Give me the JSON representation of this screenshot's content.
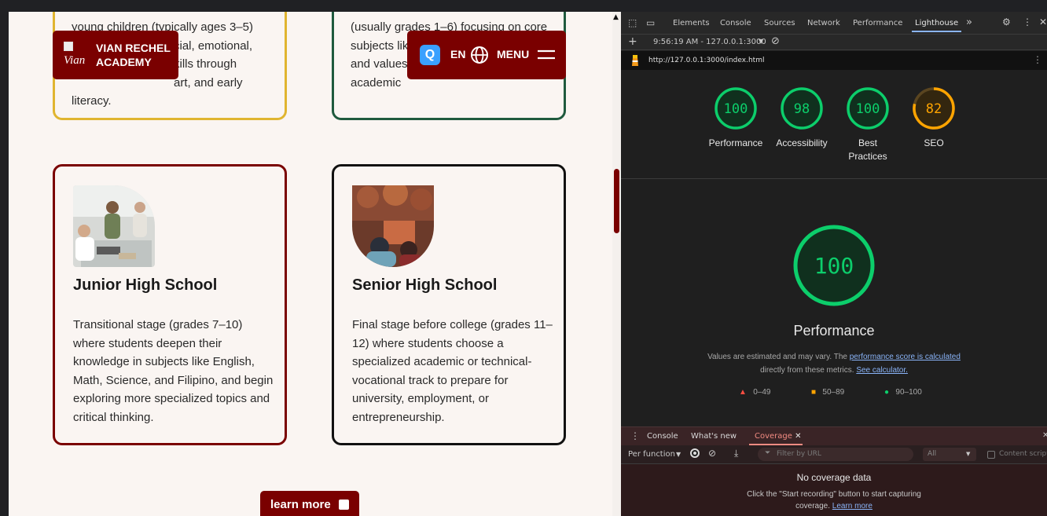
{
  "site": {
    "logo": {
      "alt_text": "Vian",
      "name_line1": "VIAN RECHEL",
      "name_line2": "ACADEMY"
    },
    "nav": {
      "lang": "EN",
      "menu_label": "MENU",
      "assistant_icon_letter": "Q"
    },
    "top_cards": {
      "left_lines": [
        "young children (typically ages 3–5)",
        "cial, emotional,",
        "kills through",
        "art, and early",
        "literacy."
      ],
      "right_lines": [
        "(usually grades 1–6) focusing on core",
        "subjects lik",
        "and values",
        "academic"
      ]
    },
    "cards": [
      {
        "title": "Junior High School",
        "description": "Transitional stage (grades 7–10) where students deepen their knowledge in subjects like English, Math, Science, and Filipino, and begin exploring more specialized topics and critical thinking.",
        "border_color": "#7a0000"
      },
      {
        "title": "Senior High School",
        "description": "Final stage before college (grades 11–12) where students choose a specialized academic or technical-vocational track to prepare for university, employment, or entrepreneurship.",
        "border_color": "#111111"
      }
    ],
    "learn_more": "learn more",
    "colors": {
      "brand": "#7a0000",
      "card_yellow": "#e0b530",
      "card_green": "#1f5a3e"
    }
  },
  "devtools": {
    "tabs": [
      "Elements",
      "Console",
      "Sources",
      "Network",
      "Performance",
      "Lighthouse"
    ],
    "active_tab": "Lighthouse",
    "more_tabs": "»",
    "report_selector": "9:56:19 AM - 127.0.0.1:3000",
    "url": "http://127.0.0.1:3000/index.html",
    "scores": [
      {
        "label": "Performance",
        "value": 100,
        "color": "#0cce6b"
      },
      {
        "label": "Accessibility",
        "value": 98,
        "color": "#0cce6b"
      },
      {
        "label": "Best Practices",
        "value": 100,
        "color": "#0cce6b"
      },
      {
        "label": "SEO",
        "value": 82,
        "color": "#ffa400"
      }
    ],
    "main_score": {
      "label": "Performance",
      "value": 100
    },
    "note_prefix": "Values are estimated and may vary. The ",
    "note_link1": "performance score is calculated",
    "note_middle": " directly from these metrics. ",
    "note_link2": "See calculator.",
    "legend": [
      {
        "range": "0–49",
        "color": "#ff4e42"
      },
      {
        "range": "50–89",
        "color": "#ffa400"
      },
      {
        "range": "90–100",
        "color": "#0cce6b"
      }
    ],
    "drawer": {
      "tabs": [
        "Console",
        "What's new",
        "Coverage"
      ],
      "active_tab": "Coverage",
      "per_function": "Per function",
      "filter_placeholder": "Filter by URL",
      "type_select": "All",
      "content_scripts": "Content scripts",
      "empty_title": "No coverage data",
      "empty_text": "Click the \"Start recording\" button to start capturing coverage. ",
      "empty_link": "Learn more"
    }
  }
}
